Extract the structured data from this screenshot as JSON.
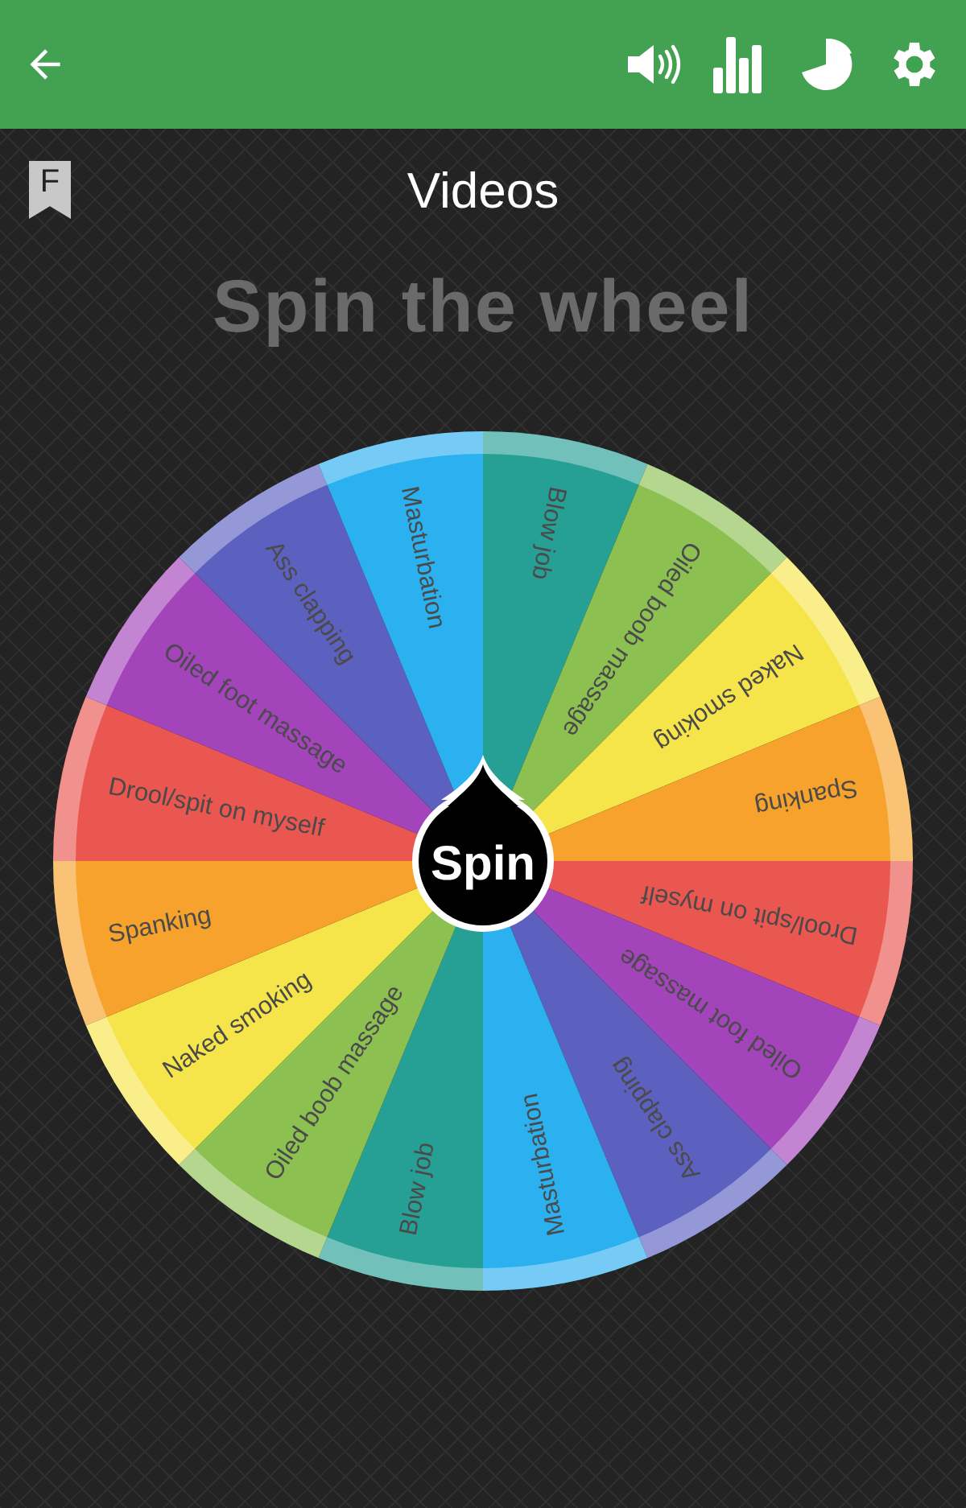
{
  "title": "Videos",
  "bookmark_letter": "F",
  "heading": "Spin the wheel",
  "wheel": {
    "segments": [
      {
        "label": "Blow job",
        "color": "#26a095"
      },
      {
        "label": "Oiled boob massage",
        "color": "#8cc152"
      },
      {
        "label": "Naked smoking",
        "color": "#f6e54a"
      },
      {
        "label": "Spanking",
        "color": "#f7a22c"
      },
      {
        "label": "Drool/spit on myself",
        "color": "#ea5650"
      },
      {
        "label": "Oiled foot massage",
        "color": "#a344bb"
      },
      {
        "label": "Ass clapping",
        "color": "#5c61c0"
      },
      {
        "label": "Masturbation",
        "color": "#2bb0f0"
      },
      {
        "label": "Blow job",
        "color": "#26a095"
      },
      {
        "label": "Oiled boob massage",
        "color": "#8cc152"
      },
      {
        "label": "Naked smoking",
        "color": "#f6e54a"
      },
      {
        "label": "Spanking",
        "color": "#f7a22c"
      },
      {
        "label": "Drool/spit on myself",
        "color": "#ea5650"
      },
      {
        "label": "Oiled foot massage",
        "color": "#a344bb"
      },
      {
        "label": "Ass clapping",
        "color": "#5c61c0"
      },
      {
        "label": "Masturbation",
        "color": "#2bb0f0"
      }
    ],
    "spin_button": "Spin"
  }
}
